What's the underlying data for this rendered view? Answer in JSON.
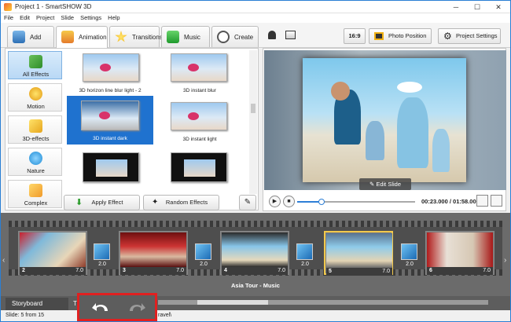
{
  "window": {
    "title": "Project 1 - SmartSHOW 3D",
    "min": "─",
    "max": "☐",
    "close": "✕"
  },
  "menu": [
    "File",
    "Edit",
    "Project",
    "Slide",
    "Settings",
    "Help"
  ],
  "tabs": [
    {
      "label": "Add"
    },
    {
      "label": "Animation"
    },
    {
      "label": "Transitions"
    },
    {
      "label": "Music"
    },
    {
      "label": "Create"
    }
  ],
  "toolbar": {
    "aspect": "16:9",
    "photo_position": "Photo Position",
    "project_settings": "Project Settings"
  },
  "categories": [
    {
      "label": "All Effects"
    },
    {
      "label": "Motion"
    },
    {
      "label": "3D-effects"
    },
    {
      "label": "Nature"
    },
    {
      "label": "Complex"
    }
  ],
  "effects": [
    {
      "label": "3D horizon line blur light - 2"
    },
    {
      "label": "3D instant blur"
    },
    {
      "label": "3D instant dark"
    },
    {
      "label": "3D instant light"
    },
    {
      "label": ""
    },
    {
      "label": ""
    }
  ],
  "buttons": {
    "apply": "Apply Effect",
    "random": "Random Effects"
  },
  "preview": {
    "edit_slide": "Edit Slide",
    "time": "00:23.000 / 01:58.000"
  },
  "slides": [
    {
      "num": "2",
      "dur": "7.0"
    },
    {
      "num": "3",
      "dur": "7.0"
    },
    {
      "num": "4",
      "dur": "7.0"
    },
    {
      "num": "5",
      "dur": "7.0"
    },
    {
      "num": "6",
      "dur": "7.0"
    }
  ],
  "transitions": [
    "2.0",
    "2.0",
    "2.0",
    "2.0"
  ],
  "music": "Asia Tour - Music",
  "bottom_tabs": {
    "storyboard": "Storyboard",
    "timeline": "Tim"
  },
  "status": {
    "left": "Slide: 5 from 15",
    "path": "ravel\\"
  },
  "colors": {
    "accent": "#1f72cf",
    "highlight": "#e02020",
    "current_slide": "#f2c94c"
  }
}
